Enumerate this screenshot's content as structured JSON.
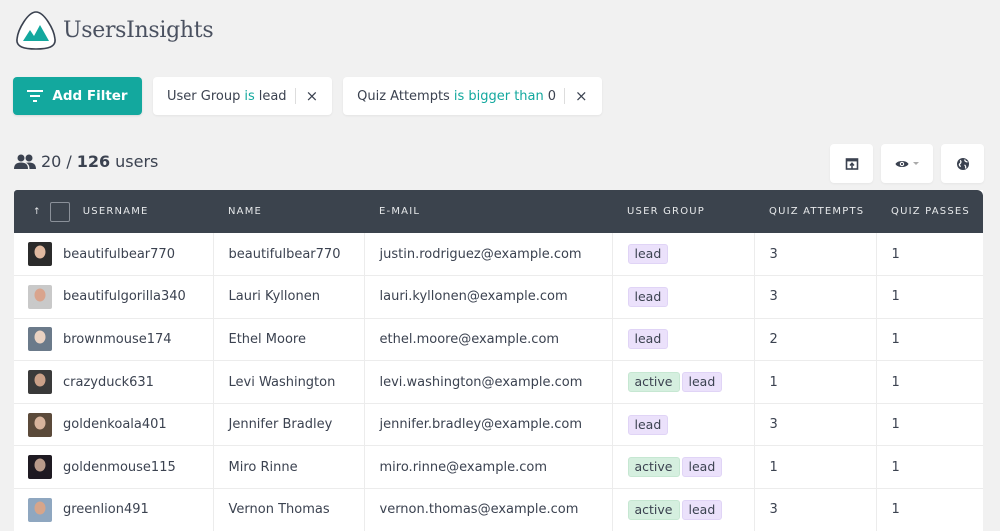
{
  "app": {
    "title": "UsersInsights",
    "brand_color": "#13a89e"
  },
  "toolbar": {
    "add_filter_label": "Add Filter",
    "filters": [
      {
        "field": "User Group",
        "operator": "is",
        "value": "lead"
      },
      {
        "field": "Quiz Attempts",
        "operator": "is bigger than",
        "value": "0"
      }
    ],
    "close_glyph": "×"
  },
  "summary": {
    "shown": "20",
    "separator": "/",
    "total": "126",
    "unit": "users"
  },
  "table": {
    "sort_glyph": "↑",
    "columns": [
      "Username",
      "Name",
      "E-mail",
      "User Group",
      "Quiz Attempts",
      "Quiz Passes"
    ],
    "rows": [
      {
        "username": "beautifulbear770",
        "name": "beautifulbear770",
        "email": "justin.rodriguez@example.com",
        "groups": [
          "lead"
        ],
        "quiz_attempts": "3",
        "quiz_passes": "1",
        "avatar_colors": [
          "#2b2b2b",
          "#e0b9a0"
        ]
      },
      {
        "username": "beautifulgorilla340",
        "name": "Lauri Kyllonen",
        "email": "lauri.kyllonen@example.com",
        "groups": [
          "lead"
        ],
        "quiz_attempts": "3",
        "quiz_passes": "1",
        "avatar_colors": [
          "#c9c9c9",
          "#d9a48d"
        ]
      },
      {
        "username": "brownmouse174",
        "name": "Ethel Moore",
        "email": "ethel.moore@example.com",
        "groups": [
          "lead"
        ],
        "quiz_attempts": "2",
        "quiz_passes": "1",
        "avatar_colors": [
          "#6b7a8a",
          "#ead2c2"
        ]
      },
      {
        "username": "crazyduck631",
        "name": "Levi Washington",
        "email": "levi.washington@example.com",
        "groups": [
          "active",
          "lead"
        ],
        "quiz_attempts": "1",
        "quiz_passes": "1",
        "avatar_colors": [
          "#3a3a3a",
          "#caa088"
        ]
      },
      {
        "username": "goldenkoala401",
        "name": "Jennifer Bradley",
        "email": "jennifer.bradley@example.com",
        "groups": [
          "lead"
        ],
        "quiz_attempts": "3",
        "quiz_passes": "1",
        "avatar_colors": [
          "#5b4a3a",
          "#d8b49c"
        ]
      },
      {
        "username": "goldenmouse115",
        "name": "Miro Rinne",
        "email": "miro.rinne@example.com",
        "groups": [
          "active",
          "lead"
        ],
        "quiz_attempts": "1",
        "quiz_passes": "1",
        "avatar_colors": [
          "#1f1a22",
          "#b89a8a"
        ]
      },
      {
        "username": "greenlion491",
        "name": "Vernon Thomas",
        "email": "vernon.thomas@example.com",
        "groups": [
          "active",
          "lead"
        ],
        "quiz_attempts": "3",
        "quiz_passes": "1",
        "avatar_colors": [
          "#8fa7c0",
          "#d7a58a"
        ]
      }
    ]
  }
}
